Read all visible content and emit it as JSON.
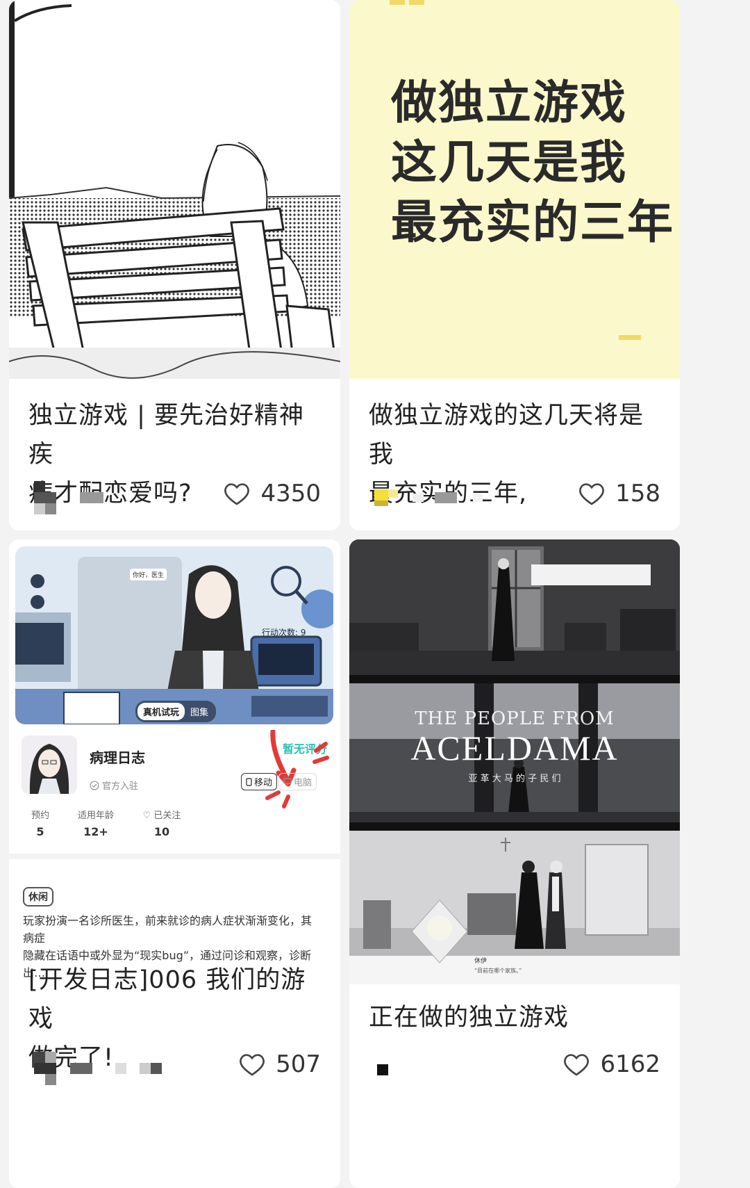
{
  "cards": [
    {
      "title_line1": "独立游戏 | 要先治好精神疾",
      "title_line2": "病才配恋爱吗?",
      "likes": "4350"
    },
    {
      "image_text_line1": "做独立游戏",
      "image_text_line2": "这几天是我",
      "image_text_line3": "最充实的三年",
      "title_line1": "做独立游戏的这几天将是我",
      "title_line2": "最充实的三年,",
      "likes": "158"
    },
    {
      "screenshot": {
        "sign_text": "你好，医生",
        "action_count": "行动次数: 9",
        "trial_button": "真机试玩",
        "gallery_tab": "图集"
      },
      "game_name": "病理日志",
      "official": "官方入驻",
      "rating": "暂无评分",
      "platform_mobile": "移动",
      "platform_pc": "电脑",
      "stats": [
        {
          "label": "预约",
          "value": "5"
        },
        {
          "label": "适用年龄",
          "value": "12+"
        },
        {
          "label": "已关注",
          "value": "10"
        }
      ],
      "tag": "休闲",
      "description_line1": "玩家扮演一名诊所医生，前来就诊的病人症状渐渐变化，其病症",
      "description_line2": "隐藏在话语中或外显为“现实bug”，通过问诊和观察，诊断出…",
      "title_line1": "[开发日志]006 我们的游戏",
      "title_line2": "做完了!",
      "likes": "507"
    },
    {
      "game_title_line1": "THE PEOPLE FROM",
      "game_title_line2": "ACELDAMA",
      "game_subtitle": "亚 革 大 马 的 子 民 们",
      "speaker_name": "休伊",
      "dialogue": "“目前在哪个家族。”",
      "title_line1": "正在做的独立游戏",
      "likes": "6162"
    }
  ],
  "colors": {
    "background": "#f3f3f3",
    "card": "#ffffff",
    "yellow": "#fbf8cc",
    "rating_green": "#27c3b4",
    "annotation_red": "#e53935"
  },
  "icons": [
    "heart-outline-icon",
    "phone-icon",
    "monitor-icon",
    "verified-icon"
  ]
}
